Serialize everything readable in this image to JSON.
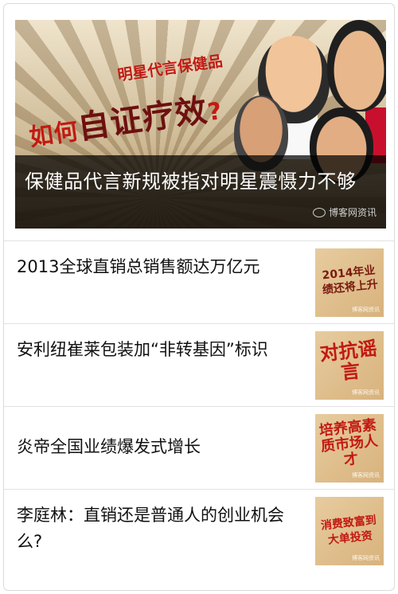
{
  "hero": {
    "tagline": "明星代言保健品",
    "question_a": "如何",
    "question_b": "自证疗效",
    "question_c": "?",
    "title": "保健品代言新规被指对明星震慑力不够",
    "watermark": "博客网资讯"
  },
  "articles": [
    {
      "title": "2013全球直销总销售额达万亿元",
      "thumb_text": "2014年业绩还将上升",
      "thumb_watermark": "博客网资讯"
    },
    {
      "title": "安利纽崔莱包装加“非转基因”标识",
      "thumb_text": "对抗谣言",
      "thumb_watermark": "博客网资讯"
    },
    {
      "title": "炎帝全国业绩爆发式增长",
      "thumb_text": "培养高素质市场人才",
      "thumb_watermark": "博客网资讯"
    },
    {
      "title": "李庭林：直销还是普通人的创业机会么?",
      "thumb_text": "消费致富到大单投资",
      "thumb_watermark": "博客网资讯"
    }
  ],
  "colors": {
    "accent_red": "#c21a12",
    "overlay": "#000000"
  }
}
